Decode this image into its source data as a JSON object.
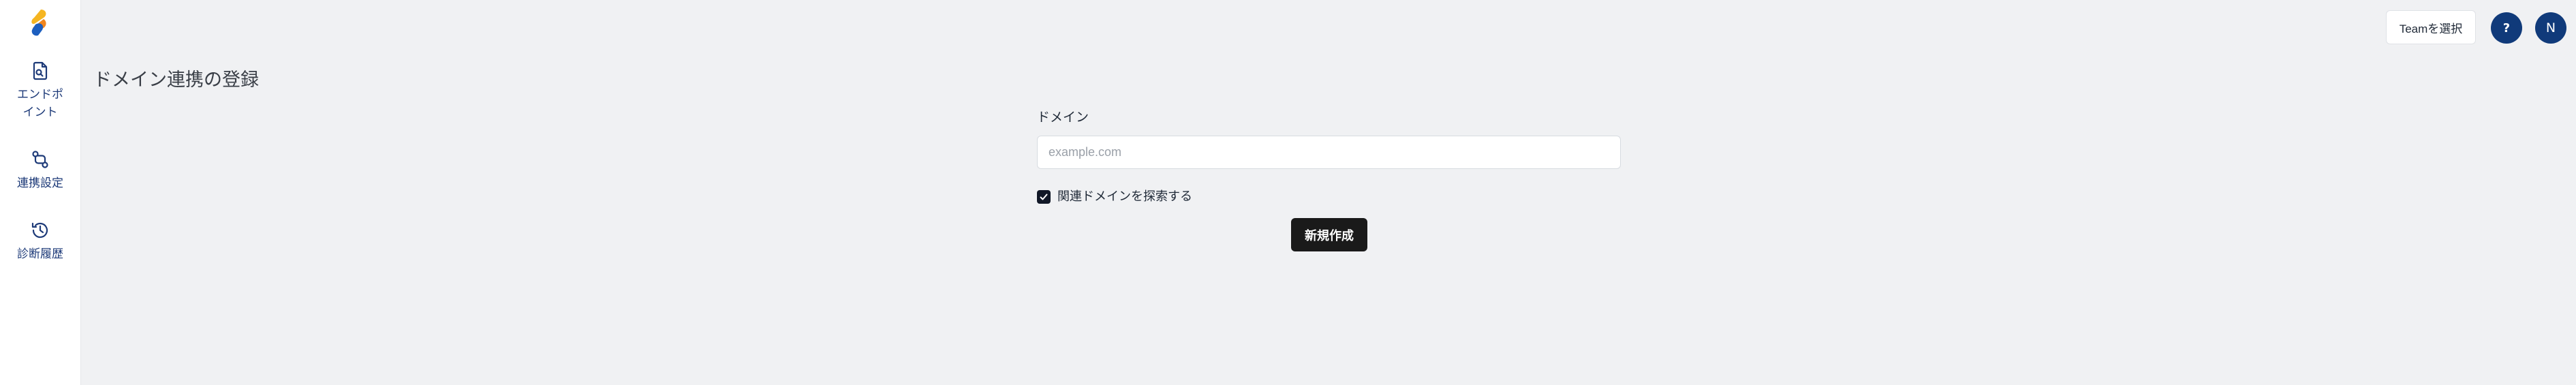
{
  "sidebar": {
    "logo_icon": "brand-logo-icon",
    "items": [
      {
        "label": "エンドポイント",
        "icon": "endpoint-document-icon"
      },
      {
        "label": "連携設定",
        "icon": "link-settings-icon"
      },
      {
        "label": "診断履歴",
        "icon": "history-icon"
      }
    ]
  },
  "header": {
    "team_button_label": "Teamを選択",
    "help_label": "?",
    "avatar_initial": "N"
  },
  "page": {
    "title": "ドメイン連携の登録"
  },
  "form": {
    "domain_label": "ドメイン",
    "domain_value": "",
    "domain_placeholder": "example.com",
    "search_related_label": "関連ドメインを探索する",
    "search_related_checked": true,
    "submit_label": "新規作成"
  },
  "colors": {
    "nav_text": "#1d3a78",
    "accent_dark_blue": "#103a7a",
    "primary_button": "#1a1a1a",
    "page_background": "#f0f1f3"
  }
}
